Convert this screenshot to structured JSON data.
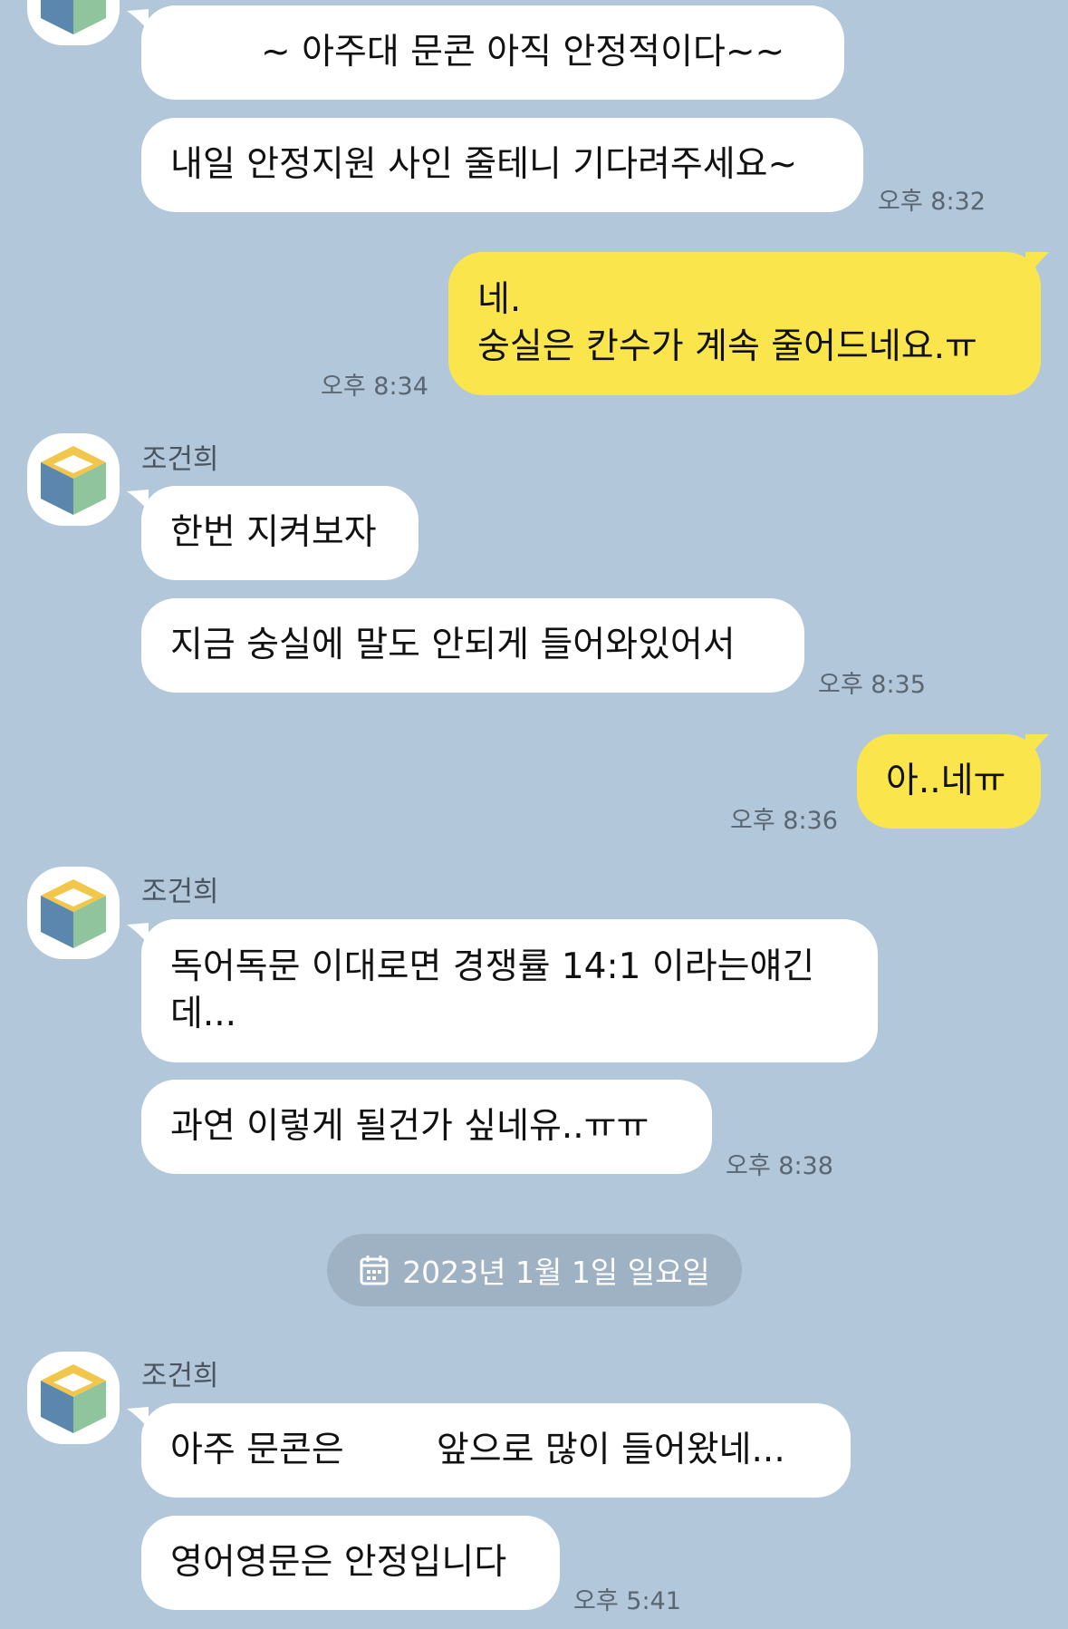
{
  "colors": {
    "background": "#b2c7d9",
    "incoming_bubble": "#ffffff",
    "outgoing_bubble": "#fae54d",
    "date_pill": "#9fb2c4"
  },
  "messages": [
    {
      "id": "m1",
      "side": "in",
      "text": "~ 아주대 문콘 아직 안정적이다~~"
    },
    {
      "id": "m2",
      "side": "in",
      "text": "내일 안정지원 사인 줄테니 기다려주세요~",
      "time": "오후 8:32"
    },
    {
      "id": "m3",
      "side": "out",
      "lines": [
        "네.",
        "숭실은 칸수가 계속 줄어드네요.ㅠ"
      ],
      "time": "오후 8:34"
    },
    {
      "id": "m4",
      "side": "in",
      "sender": "조건희",
      "text": "한번 지켜보자"
    },
    {
      "id": "m5",
      "side": "in",
      "text": "지금 숭실에 말도 안되게 들어와있어서",
      "time": "오후 8:35"
    },
    {
      "id": "m6",
      "side": "out",
      "text": "아..네ㅠ",
      "time": "오후 8:36"
    },
    {
      "id": "m7",
      "side": "in",
      "sender": "조건희",
      "lines": [
        "독어독문 이대로면 경쟁률 14:1 이라는얘긴",
        "데..."
      ]
    },
    {
      "id": "m8",
      "side": "in",
      "text": "과연 이렇게 될건가 싶네유..ㅠㅠ",
      "time": "오후 8:38"
    },
    {
      "id": "m9",
      "side": "in",
      "sender": "조건희",
      "text_before": "아주 문콘은",
      "text_after": "앞으로 많이 들어왔네..."
    },
    {
      "id": "m10",
      "side": "in",
      "text": "영어영문은 안정입니다",
      "time": "오후 5:41"
    }
  ],
  "date_divider": {
    "icon": "calendar-icon",
    "label": "2023년 1월 1일 일요일"
  }
}
